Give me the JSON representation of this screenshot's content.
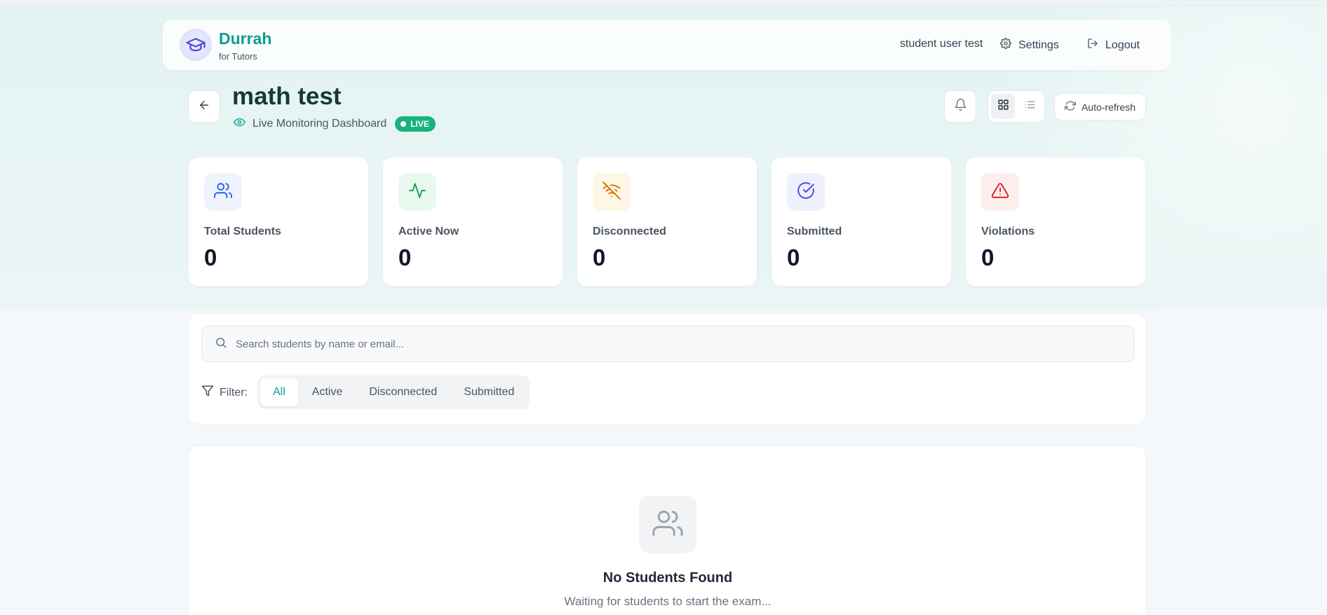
{
  "header": {
    "brand_name": "Durrah",
    "brand_sub": "for Tutors",
    "user_name": "student user test",
    "settings_label": "Settings",
    "logout_label": "Logout"
  },
  "exam": {
    "title": "math test",
    "subtitle": "Live Monitoring Dashboard",
    "live_badge": "LIVE"
  },
  "toolbar": {
    "auto_refresh_label": "Auto-refresh"
  },
  "stats": [
    {
      "label": "Total Students",
      "value": "0",
      "icon": "users-icon",
      "color": "#2563eb",
      "bg": "#eef3fe"
    },
    {
      "label": "Active Now",
      "value": "0",
      "icon": "activity-icon",
      "color": "#16a34a",
      "bg": "#e9f9f0"
    },
    {
      "label": "Disconnected",
      "value": "0",
      "icon": "wifi-off-icon",
      "color": "#d97706",
      "bg": "#fef7e6"
    },
    {
      "label": "Submitted",
      "value": "0",
      "icon": "check-circle-icon",
      "color": "#4f46e5",
      "bg": "#eef0fd"
    },
    {
      "label": "Violations",
      "value": "0",
      "icon": "alert-triangle-icon",
      "color": "#dc2626",
      "bg": "#fdeeee"
    }
  ],
  "search": {
    "placeholder": "Search students by name or email...",
    "value": ""
  },
  "filter": {
    "label": "Filter:",
    "tabs": [
      "All",
      "Active",
      "Disconnected",
      "Submitted"
    ],
    "selected": "All"
  },
  "empty_state": {
    "title": "No Students Found",
    "description": "Waiting for students to start the exam..."
  },
  "colors": {
    "accent": "#0f9c93",
    "live": "#16b37b",
    "title": "#16393a"
  }
}
